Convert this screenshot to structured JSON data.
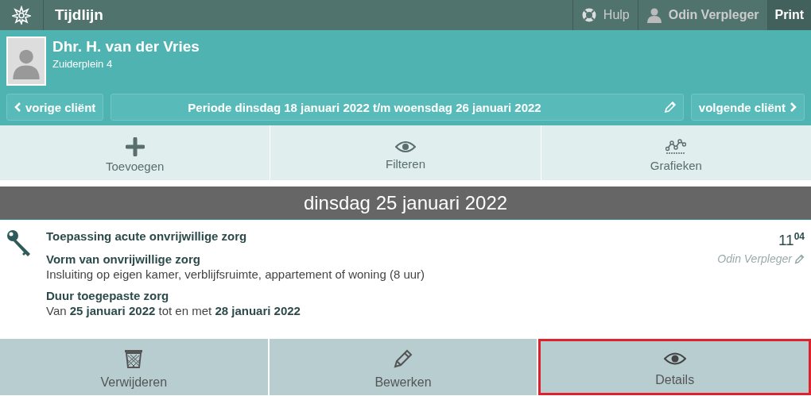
{
  "top_bar": {
    "title": "Tijdlijn",
    "help": "Hulp",
    "user": "Odin Verpleger",
    "print": "Print"
  },
  "patient": {
    "name": "Dhr. H. van der Vries",
    "address": "Zuiderplein 4"
  },
  "navigation": {
    "previous": "vorige cliënt",
    "period": "Periode dinsdag 18 januari 2022 t/m woensdag 26 januari 2022",
    "next": "volgende cliënt"
  },
  "toolbar": [
    {
      "kind": "add",
      "label": "Toevoegen"
    },
    {
      "kind": "view",
      "label": "Filteren"
    },
    {
      "kind": "chart",
      "label": "Grafieken"
    }
  ],
  "day_header": "dinsdag 25 januari 2022",
  "entry": {
    "title": "Toepassing acute onvrijwillige zorg",
    "time": "11$^{04}$",
    "author": "Odin Verpleger",
    "fields": [
      {
        "label": "Vorm van onvrijwillige zorg",
        "value": "Insluiting op eigen kamer, verblijfsruimte, appartement of woning (8 uur)"
      },
      {
        "label": "Duur toegepaste zorg",
        "value": "Van **25 januari 2022** tot en met **28 januari 2022**"
      }
    ]
  },
  "actions": [
    {
      "kind": "delete",
      "label": "Verwijderen",
      "highlighted": false
    },
    {
      "kind": "edit",
      "label": "Bewerken",
      "highlighted": false
    },
    {
      "kind": "view",
      "label": "Details",
      "highlighted": true
    }
  ]
}
